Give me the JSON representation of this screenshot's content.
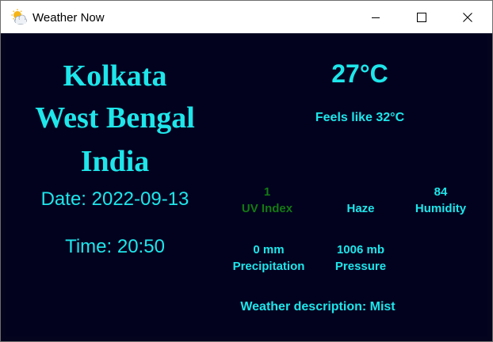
{
  "window": {
    "title": "Weather Now",
    "app_icon": "sun-cloud-icon"
  },
  "location": {
    "city": "Kolkata",
    "region": "West Bengal",
    "country": "India"
  },
  "date_text": "Date: 2022-09-13",
  "time_text": "Time: 20:50",
  "temperature": "27°C",
  "feels_like": "Feels like 32°C",
  "stats": {
    "uv": {
      "value": "1",
      "label": "UV Index"
    },
    "condition": {
      "label": "Haze"
    },
    "humidity": {
      "value": "84",
      "label": "Humidity"
    },
    "precipitation": {
      "value": "0 mm",
      "label": "Precipitation"
    },
    "pressure": {
      "value": "1006 mb",
      "label": "Pressure"
    }
  },
  "description": "Weather description: Mist",
  "colors": {
    "background": "#02021f",
    "accent": "#1ee6ea",
    "uv_green": "#137a13"
  }
}
